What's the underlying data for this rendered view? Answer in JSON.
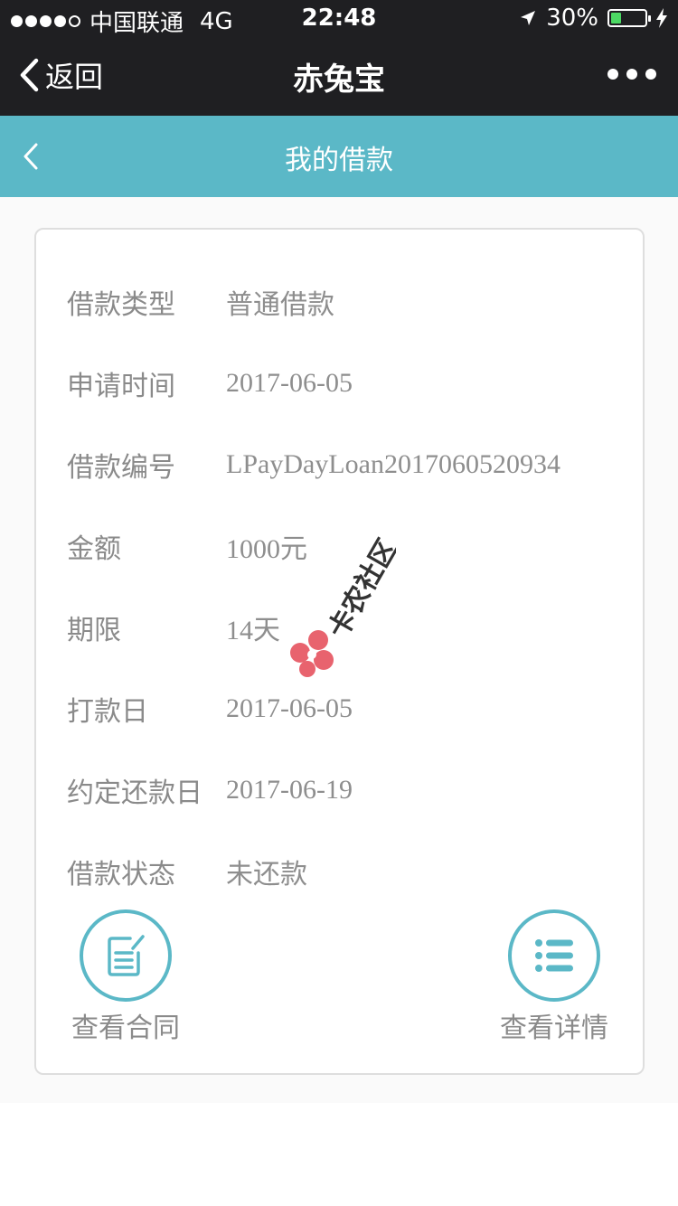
{
  "status_bar": {
    "carrier": "中国联通",
    "network": "4G",
    "time": "22:48",
    "battery": "30%",
    "battery_level": 0.3
  },
  "nav": {
    "back_label": "返回",
    "title": "赤兔宝"
  },
  "subheader": {
    "title": "我的借款"
  },
  "loan": {
    "rows": [
      {
        "label": "借款类型",
        "value": "普通借款"
      },
      {
        "label": "申请时间",
        "value": "2017-06-05"
      },
      {
        "label": "借款编号",
        "value": "LPayDayLoan2017060520934"
      },
      {
        "label": "金额",
        "value": "1000元"
      },
      {
        "label": "期限",
        "value": "14天"
      },
      {
        "label": "打款日",
        "value": "2017-06-05"
      },
      {
        "label": "约定还款日",
        "value": "2017-06-19"
      },
      {
        "label": "借款状态",
        "value": "未还款"
      }
    ]
  },
  "actions": {
    "contract_label": "查看合同",
    "details_label": "查看详情"
  },
  "watermark": {
    "text": "卡农社区"
  },
  "colors": {
    "accent": "#5bb8c7",
    "dark_bar": "#1f1f22",
    "label_gray": "#8a8a8a",
    "watermark_red": "#e8636e"
  }
}
